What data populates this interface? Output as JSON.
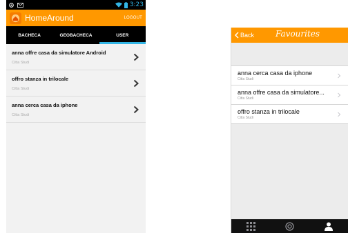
{
  "android": {
    "status": {
      "time": "3:23"
    },
    "app_title": "HomeAround",
    "logout_label": "LOGOUT",
    "tabs": [
      {
        "label": "BACHECA"
      },
      {
        "label": "GEOBACHECA"
      },
      {
        "label": "USER"
      }
    ],
    "items": [
      {
        "title": "anna offre casa da simulatore Android",
        "subtitle": "Citta Studi"
      },
      {
        "title": "offro stanza in trilocale",
        "subtitle": "Citta Studi"
      },
      {
        "title": "anna cerca casa da iphone",
        "subtitle": "Citta Studi"
      }
    ],
    "colors": {
      "accent": "#ff9800",
      "tab_indicator": "#33b5e5"
    }
  },
  "ios": {
    "back_label": "Back",
    "nav_title": "Favourites",
    "items": [
      {
        "title": "anna cerca casa da iphone",
        "subtitle": "Citta Studi"
      },
      {
        "title": "anna offre casa da simulatore...",
        "subtitle": "Citta Studi"
      },
      {
        "title": "offro stanza in trilocale",
        "subtitle": "Citta Studi"
      }
    ],
    "tabbar": [
      {
        "icon": "grid-icon"
      },
      {
        "icon": "target-icon"
      },
      {
        "icon": "user-icon"
      }
    ],
    "colors": {
      "nav": "#ff9800",
      "tabbar": "#111111"
    }
  }
}
